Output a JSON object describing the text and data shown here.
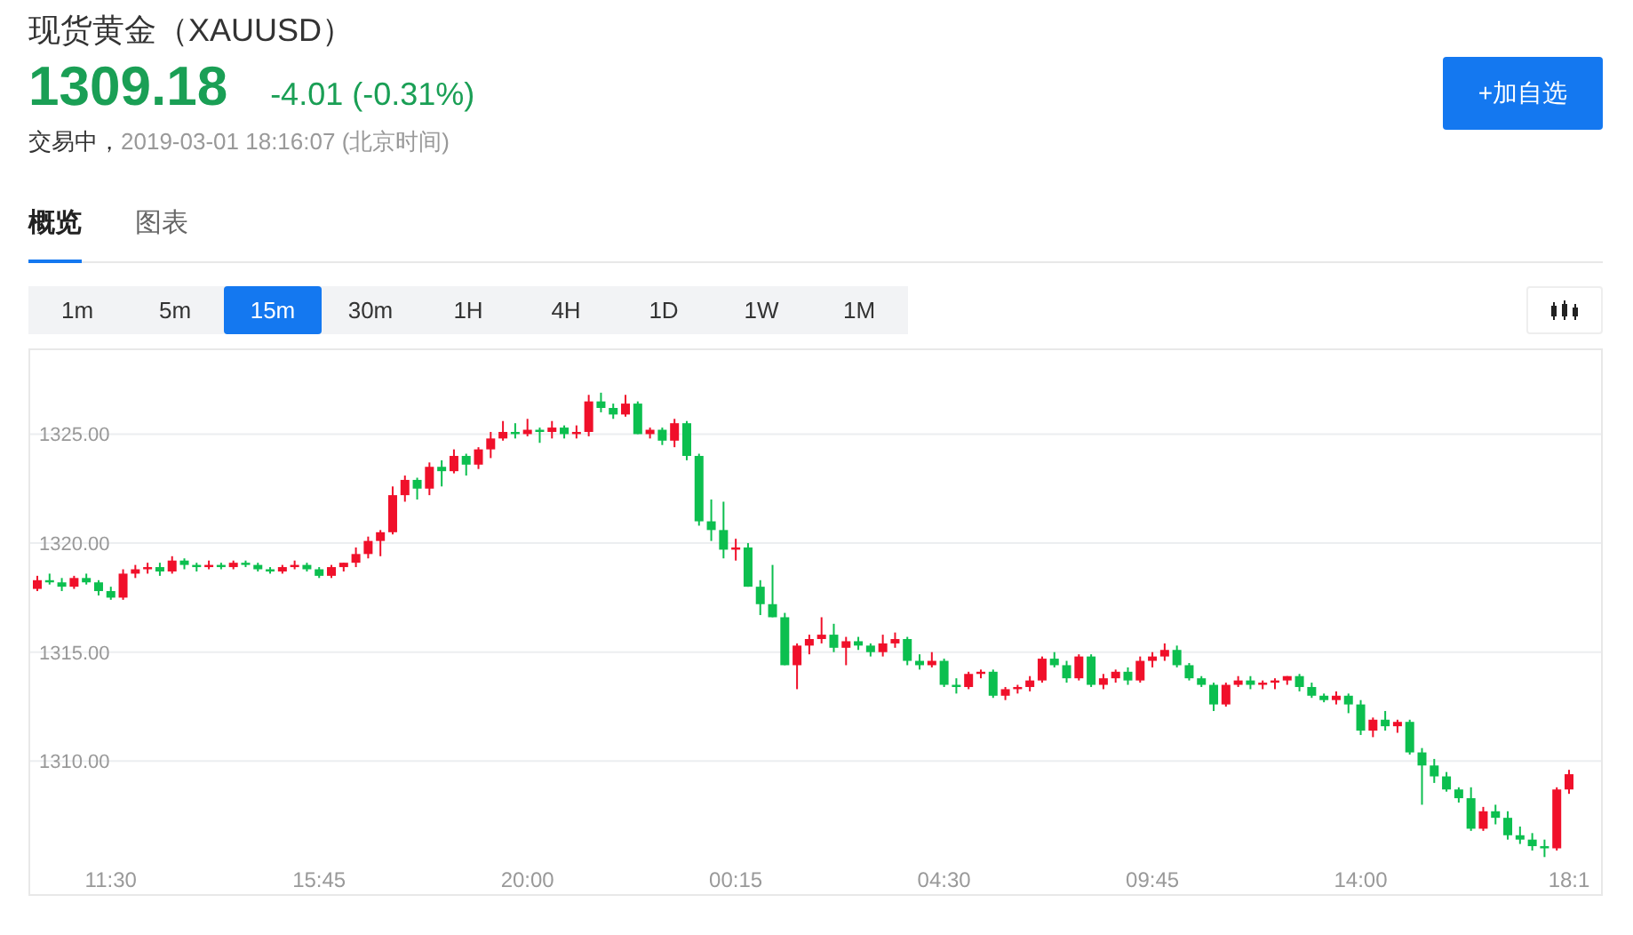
{
  "header": {
    "title": "现货黄金（XAUUSD）",
    "price": "1309.18",
    "change": "-4.01 (-0.31%)",
    "status": "交易中，",
    "timestamp": "2019-03-01 18:16:07 (北京时间)"
  },
  "watch_button": "+加自选",
  "tabs": [
    {
      "label": "概览",
      "selected": true
    },
    {
      "label": "图表",
      "selected": false
    }
  ],
  "intervals": [
    {
      "label": "1m",
      "selected": false
    },
    {
      "label": "5m",
      "selected": false
    },
    {
      "label": "15m",
      "selected": true
    },
    {
      "label": "30m",
      "selected": false
    },
    {
      "label": "1H",
      "selected": false
    },
    {
      "label": "4H",
      "selected": false
    },
    {
      "label": "1D",
      "selected": false
    },
    {
      "label": "1W",
      "selected": false
    },
    {
      "label": "1M",
      "selected": false
    }
  ],
  "chart": {
    "chart_data": {
      "type": "candlestick",
      "grid": true,
      "ylim": [
        1303.9,
        1328.85
      ],
      "yticks": [
        {
          "value": 1325,
          "label": "1325.00"
        },
        {
          "value": 1320,
          "label": "1320.00"
        },
        {
          "value": 1315,
          "label": "1315.00"
        },
        {
          "value": 1310,
          "label": "1310.00"
        }
      ],
      "categories": [
        null,
        null,
        null,
        null,
        null,
        null,
        "11:30",
        null,
        null,
        null,
        null,
        null,
        null,
        null,
        null,
        null,
        null,
        null,
        null,
        null,
        null,
        null,
        null,
        "15:45",
        null,
        null,
        null,
        null,
        null,
        null,
        null,
        null,
        null,
        null,
        null,
        null,
        null,
        null,
        null,
        null,
        "20:00",
        null,
        null,
        null,
        null,
        null,
        null,
        null,
        null,
        null,
        null,
        null,
        null,
        null,
        null,
        null,
        null,
        "00:15",
        null,
        null,
        null,
        null,
        null,
        null,
        null,
        null,
        null,
        null,
        null,
        null,
        null,
        null,
        null,
        null,
        "04:30",
        null,
        null,
        null,
        null,
        null,
        null,
        null,
        null,
        null,
        null,
        null,
        null,
        null,
        null,
        null,
        null,
        "09:45",
        null,
        null,
        null,
        null,
        null,
        null,
        null,
        null,
        null,
        null,
        null,
        null,
        null,
        null,
        null,
        null,
        "14:00",
        null,
        null,
        null,
        null,
        null,
        null,
        null,
        null,
        null,
        null,
        null,
        null,
        null,
        null,
        null,
        null,
        "18:1"
      ],
      "ohlc": [
        [
          1317.9,
          1318.5,
          1317.8,
          1318.3
        ],
        [
          1318.3,
          1318.6,
          1318.1,
          1318.2
        ],
        [
          1318.2,
          1318.4,
          1317.8,
          1318.0
        ],
        [
          1318.0,
          1318.5,
          1317.9,
          1318.4
        ],
        [
          1318.4,
          1318.6,
          1318.1,
          1318.2
        ],
        [
          1318.2,
          1318.3,
          1317.6,
          1317.8
        ],
        [
          1317.8,
          1318.0,
          1317.4,
          1317.5
        ],
        [
          1317.5,
          1318.8,
          1317.4,
          1318.6
        ],
        [
          1318.6,
          1319.0,
          1318.4,
          1318.8
        ],
        [
          1318.8,
          1319.1,
          1318.6,
          1318.9
        ],
        [
          1318.9,
          1319.1,
          1318.5,
          1318.7
        ],
        [
          1318.7,
          1319.4,
          1318.6,
          1319.2
        ],
        [
          1319.2,
          1319.3,
          1318.8,
          1319.0
        ],
        [
          1319.0,
          1319.1,
          1318.7,
          1318.9
        ],
        [
          1318.9,
          1319.2,
          1318.8,
          1319.0
        ],
        [
          1319.0,
          1319.1,
          1318.8,
          1318.9
        ],
        [
          1318.9,
          1319.2,
          1318.8,
          1319.1
        ],
        [
          1319.1,
          1319.2,
          1318.9,
          1319.0
        ],
        [
          1319.0,
          1319.1,
          1318.7,
          1318.8
        ],
        [
          1318.8,
          1318.9,
          1318.6,
          1318.7
        ],
        [
          1318.7,
          1319.0,
          1318.6,
          1318.9
        ],
        [
          1318.9,
          1319.2,
          1318.8,
          1319.0
        ],
        [
          1319.0,
          1319.1,
          1318.7,
          1318.8
        ],
        [
          1318.8,
          1318.9,
          1318.4,
          1318.5
        ],
        [
          1318.5,
          1319.0,
          1318.4,
          1318.9
        ],
        [
          1318.9,
          1319.1,
          1318.7,
          1319.1
        ],
        [
          1319.1,
          1319.8,
          1318.9,
          1319.5
        ],
        [
          1319.5,
          1320.3,
          1319.3,
          1320.1
        ],
        [
          1320.1,
          1320.6,
          1319.4,
          1320.5
        ],
        [
          1320.5,
          1322.6,
          1320.4,
          1322.2
        ],
        [
          1322.2,
          1323.1,
          1321.9,
          1322.9
        ],
        [
          1322.9,
          1323.0,
          1322.0,
          1322.5
        ],
        [
          1322.5,
          1323.7,
          1322.2,
          1323.5
        ],
        [
          1323.5,
          1323.8,
          1322.6,
          1323.3
        ],
        [
          1323.3,
          1324.3,
          1323.2,
          1324.0
        ],
        [
          1324.0,
          1324.1,
          1323.1,
          1323.6
        ],
        [
          1323.6,
          1324.4,
          1323.4,
          1324.3
        ],
        [
          1324.3,
          1325.1,
          1323.9,
          1324.8
        ],
        [
          1324.8,
          1325.6,
          1324.7,
          1325.1
        ],
        [
          1325.1,
          1325.5,
          1324.8,
          1325.0
        ],
        [
          1325.0,
          1325.7,
          1324.9,
          1325.2
        ],
        [
          1325.2,
          1325.3,
          1324.6,
          1325.1
        ],
        [
          1325.1,
          1325.6,
          1324.8,
          1325.3
        ],
        [
          1325.3,
          1325.4,
          1324.8,
          1325.0
        ],
        [
          1325.0,
          1325.4,
          1324.8,
          1325.1
        ],
        [
          1325.1,
          1326.8,
          1324.9,
          1326.5
        ],
        [
          1326.5,
          1326.9,
          1326.0,
          1326.2
        ],
        [
          1326.2,
          1326.4,
          1325.7,
          1325.9
        ],
        [
          1325.9,
          1326.8,
          1325.8,
          1326.4
        ],
        [
          1326.4,
          1326.5,
          1325.0,
          1325.0
        ],
        [
          1325.0,
          1325.3,
          1324.8,
          1325.2
        ],
        [
          1325.2,
          1325.3,
          1324.5,
          1324.7
        ],
        [
          1324.7,
          1325.7,
          1324.4,
          1325.5
        ],
        [
          1325.5,
          1325.6,
          1323.8,
          1324.0
        ],
        [
          1324.0,
          1324.1,
          1320.8,
          1321.0
        ],
        [
          1321.0,
          1322.0,
          1320.1,
          1320.6
        ],
        [
          1320.6,
          1321.9,
          1319.3,
          1319.7
        ],
        [
          1319.7,
          1320.2,
          1319.2,
          1319.8
        ],
        [
          1319.8,
          1320.0,
          1318.0,
          1318.0
        ],
        [
          1318.0,
          1318.3,
          1316.7,
          1317.2
        ],
        [
          1317.2,
          1319.0,
          1316.6,
          1316.6
        ],
        [
          1316.6,
          1316.8,
          1314.4,
          1314.4
        ],
        [
          1314.4,
          1315.4,
          1313.3,
          1315.3
        ],
        [
          1315.3,
          1315.8,
          1314.9,
          1315.6
        ],
        [
          1315.6,
          1316.6,
          1315.4,
          1315.8
        ],
        [
          1315.8,
          1316.3,
          1315.0,
          1315.2
        ],
        [
          1315.2,
          1315.7,
          1314.4,
          1315.5
        ],
        [
          1315.5,
          1315.7,
          1315.1,
          1315.3
        ],
        [
          1315.3,
          1315.4,
          1314.8,
          1315.0
        ],
        [
          1315.0,
          1315.8,
          1314.8,
          1315.4
        ],
        [
          1315.4,
          1315.9,
          1315.2,
          1315.6
        ],
        [
          1315.6,
          1315.7,
          1314.4,
          1314.6
        ],
        [
          1314.6,
          1314.9,
          1314.2,
          1314.4
        ],
        [
          1314.4,
          1315.0,
          1314.3,
          1314.6
        ],
        [
          1314.6,
          1314.7,
          1313.4,
          1313.5
        ],
        [
          1313.5,
          1313.8,
          1313.1,
          1313.4
        ],
        [
          1313.4,
          1314.1,
          1313.3,
          1314.0
        ],
        [
          1314.0,
          1314.2,
          1313.8,
          1314.1
        ],
        [
          1314.1,
          1314.2,
          1312.9,
          1313.0
        ],
        [
          1313.0,
          1313.4,
          1312.8,
          1313.3
        ],
        [
          1313.3,
          1313.5,
          1313.1,
          1313.4
        ],
        [
          1313.4,
          1313.9,
          1313.2,
          1313.7
        ],
        [
          1313.7,
          1314.8,
          1313.6,
          1314.7
        ],
        [
          1314.7,
          1315.0,
          1314.3,
          1314.4
        ],
        [
          1314.4,
          1314.6,
          1313.6,
          1313.8
        ],
        [
          1313.8,
          1314.9,
          1313.7,
          1314.8
        ],
        [
          1314.8,
          1314.9,
          1313.4,
          1313.5
        ],
        [
          1313.5,
          1314.0,
          1313.3,
          1313.8
        ],
        [
          1313.8,
          1314.2,
          1313.6,
          1314.1
        ],
        [
          1314.1,
          1314.3,
          1313.5,
          1313.7
        ],
        [
          1313.7,
          1314.8,
          1313.6,
          1314.6
        ],
        [
          1314.6,
          1315.0,
          1314.3,
          1314.8
        ],
        [
          1314.8,
          1315.4,
          1314.6,
          1315.1
        ],
        [
          1315.1,
          1315.3,
          1314.3,
          1314.4
        ],
        [
          1314.4,
          1314.5,
          1313.7,
          1313.8
        ],
        [
          1313.8,
          1313.9,
          1313.4,
          1313.5
        ],
        [
          1313.5,
          1313.6,
          1312.3,
          1312.6
        ],
        [
          1312.6,
          1313.6,
          1312.5,
          1313.5
        ],
        [
          1313.5,
          1313.9,
          1313.4,
          1313.7
        ],
        [
          1313.7,
          1313.9,
          1313.3,
          1313.5
        ],
        [
          1313.5,
          1313.7,
          1313.3,
          1313.6
        ],
        [
          1313.6,
          1313.8,
          1313.3,
          1313.7
        ],
        [
          1313.7,
          1313.9,
          1313.5,
          1313.9
        ],
        [
          1313.9,
          1314.0,
          1313.2,
          1313.4
        ],
        [
          1313.4,
          1313.6,
          1312.9,
          1313.0
        ],
        [
          1313.0,
          1313.1,
          1312.7,
          1312.8
        ],
        [
          1312.8,
          1313.2,
          1312.6,
          1313.0
        ],
        [
          1313.0,
          1313.1,
          1312.2,
          1312.6
        ],
        [
          1312.6,
          1312.8,
          1311.2,
          1311.4
        ],
        [
          1311.4,
          1312.0,
          1311.1,
          1311.9
        ],
        [
          1311.9,
          1312.3,
          1311.4,
          1311.6
        ],
        [
          1311.6,
          1311.9,
          1311.3,
          1311.8
        ],
        [
          1311.8,
          1311.9,
          1310.3,
          1310.4
        ],
        [
          1310.4,
          1310.6,
          1308.0,
          1309.8
        ],
        [
          1309.8,
          1310.1,
          1309.0,
          1309.3
        ],
        [
          1309.3,
          1309.5,
          1308.6,
          1308.7
        ],
        [
          1308.7,
          1308.8,
          1308.1,
          1308.3
        ],
        [
          1308.3,
          1308.8,
          1306.8,
          1306.9
        ],
        [
          1306.9,
          1307.9,
          1306.8,
          1307.7
        ],
        [
          1307.7,
          1308.0,
          1307.1,
          1307.4
        ],
        [
          1307.4,
          1307.7,
          1306.4,
          1306.6
        ],
        [
          1306.6,
          1307.0,
          1306.2,
          1306.4
        ],
        [
          1306.4,
          1306.7,
          1305.9,
          1306.1
        ],
        [
          1306.1,
          1306.4,
          1305.6,
          1306.0
        ],
        [
          1306.0,
          1308.8,
          1305.9,
          1308.7
        ],
        [
          1308.7,
          1309.6,
          1308.5,
          1309.4
        ]
      ]
    }
  }
}
